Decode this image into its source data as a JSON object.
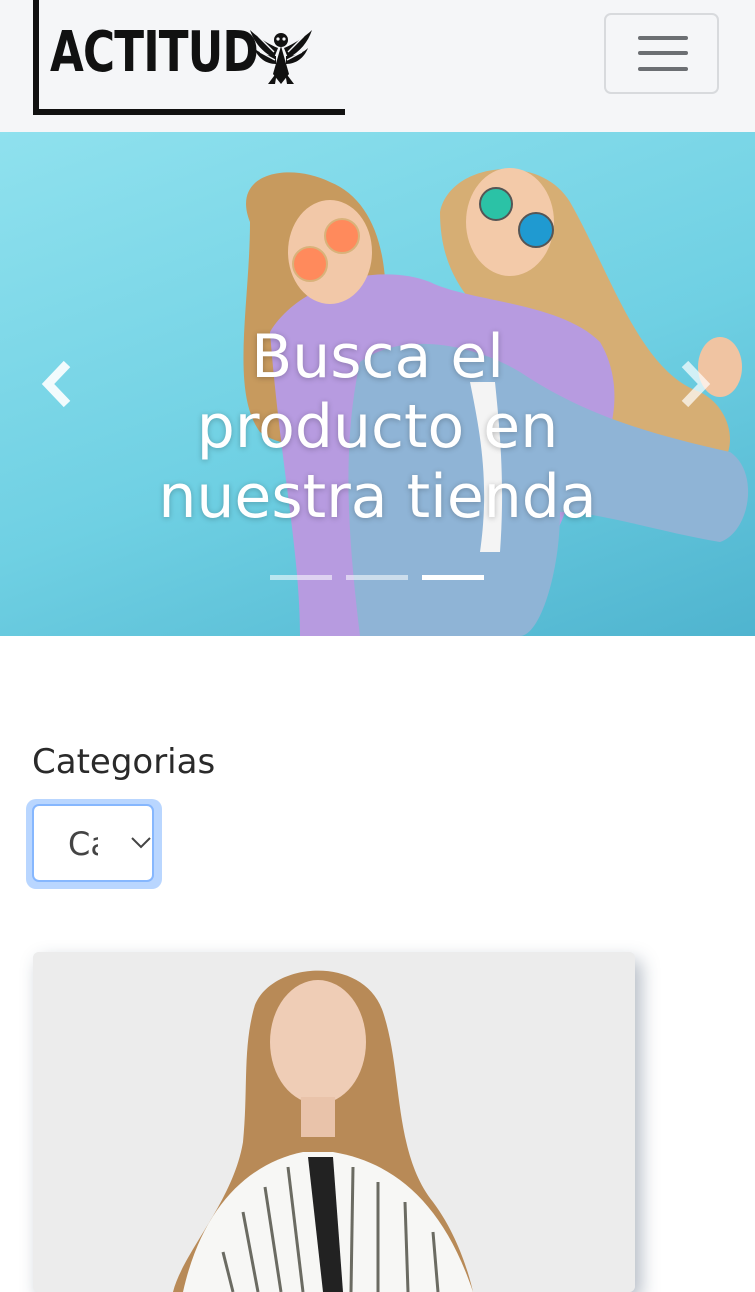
{
  "brand": {
    "name": "ACTITUD",
    "emblem_icon": "phoenix-emblem-icon"
  },
  "navbar": {
    "toggle_icon": "hamburger-menu-icon"
  },
  "carousel": {
    "caption_lines": [
      "Busca el",
      "producto en",
      "nuestra tienda"
    ],
    "prev_icon": "chevron-left-icon",
    "next_icon": "chevron-right-icon",
    "slide_count": 3,
    "active_slide": 3
  },
  "categories": {
    "label": "Categorias",
    "select_value": "Ca"
  },
  "colors": {
    "navbar_bg": "#f5f6f8",
    "focus_ring": "#86b7fe",
    "hero_bg": "#6fd0e3"
  }
}
